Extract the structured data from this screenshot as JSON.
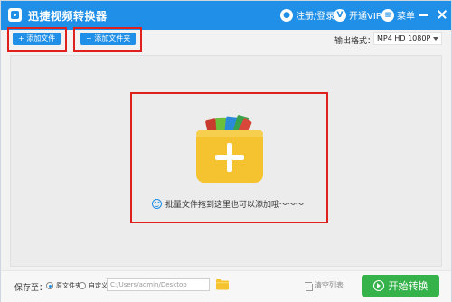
{
  "titlebar": {
    "app_title": "迅捷视频转换器",
    "login_label": "注册/登录",
    "vip_label": "开通VIP",
    "menu_label": "菜单",
    "icons": [
      "user-icon",
      "vip-icon",
      "menu-icon",
      "minimize-icon",
      "close-icon"
    ]
  },
  "toolbar": {
    "add_file_label": "+ 添加文件",
    "add_folder_label": "+ 添加文件夹",
    "output_format_label": "输出格式：",
    "output_format_value": "MP4  HD 1080P"
  },
  "drop_area": {
    "hint_text": "批量文件拖到这里也可以添加哦～～～"
  },
  "bottombar": {
    "save_to_label": "保存至：",
    "radio_original_label": "原文件夹",
    "radio_custom_label": "自定义",
    "selected_option": "原文件夹",
    "path_value": "C:/Users/admin/Desktop",
    "clear_list_label": "清空列表",
    "start_label": "开始转换"
  },
  "colors": {
    "accent": "#1f8fe8",
    "highlight": "#e0201d",
    "start_button": "#35b24a",
    "folder": "#f5c330"
  }
}
